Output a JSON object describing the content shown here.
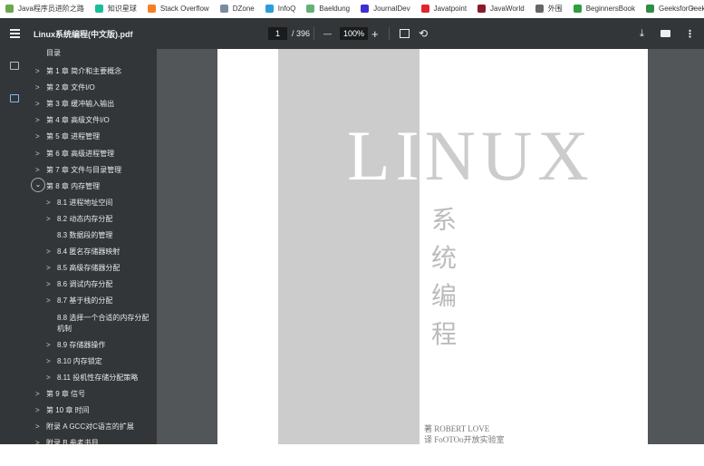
{
  "bookmarks": [
    {
      "label": "Java程序员进阶之路",
      "icon": "java-icon",
      "color": "#6aa84f"
    },
    {
      "label": "知识星球",
      "icon": "planet-icon",
      "color": "#1abc9c"
    },
    {
      "label": "Stack Overflow",
      "icon": "stackoverflow-icon",
      "color": "#f48024"
    },
    {
      "label": "DZone",
      "icon": "dzone-icon",
      "color": "#7a8ca3"
    },
    {
      "label": "InfoQ",
      "icon": "infoq-icon",
      "color": "#2d9cdb"
    },
    {
      "label": "Baeldung",
      "icon": "baeldung-icon",
      "color": "#63b175"
    },
    {
      "label": "JournalDev",
      "icon": "journaldev-icon",
      "color": "#3f2fcf"
    },
    {
      "label": "Javatpoint",
      "icon": "javatpoint-icon",
      "color": "#e3242b"
    },
    {
      "label": "JavaWorld",
      "icon": "javaworld-icon",
      "color": "#8b1a2b"
    },
    {
      "label": "外围",
      "icon": "folder-icon",
      "color": "#666666"
    },
    {
      "label": "BeginnersBook",
      "icon": "beginnersbook-icon",
      "color": "#2e9e3e"
    },
    {
      "label": "GeeksforGeeks",
      "icon": "geeksforgeeks-icon",
      "color": "#2f8d46"
    }
  ],
  "more": "»",
  "toolbar": {
    "title": "Linux系统编程(中文版).pdf",
    "page": "1",
    "total": "/ 396",
    "zoom": "100%",
    "minus": "—",
    "plus": "+"
  },
  "toc": {
    "header": "目录",
    "items": [
      {
        "label": "第 1 章 简介和主要概念",
        "level": 0,
        "chev": ">"
      },
      {
        "label": "第 2 章 文件I/O",
        "level": 0,
        "chev": ">"
      },
      {
        "label": "第 3 章 缓冲输入输出",
        "level": 0,
        "chev": ">"
      },
      {
        "label": "第 4 章 高级文件I/O",
        "level": 0,
        "chev": ">"
      },
      {
        "label": "第 5 章 进程管理",
        "level": 0,
        "chev": ">"
      },
      {
        "label": "第 6 章 高级进程管理",
        "level": 0,
        "chev": ">"
      },
      {
        "label": "第 7 章 文件与目录管理",
        "level": 0,
        "chev": ">"
      },
      {
        "label": "第 8 章 内存管理",
        "level": 0,
        "chev": "v",
        "expanded": true
      },
      {
        "label": "8.1 进程地址空间",
        "level": 1,
        "chev": ">"
      },
      {
        "label": "8.2 动态内存分配",
        "level": 1,
        "chev": ">"
      },
      {
        "label": "8.3 数据段的管理",
        "level": 1,
        "chev": ""
      },
      {
        "label": "8.4 匿名存储器映射",
        "level": 1,
        "chev": ">"
      },
      {
        "label": "8.5 高级存储器分配",
        "level": 1,
        "chev": ">"
      },
      {
        "label": "8.6 调试内存分配",
        "level": 1,
        "chev": ">"
      },
      {
        "label": "8.7 基于栈的分配",
        "level": 1,
        "chev": ">"
      },
      {
        "label": "8.8 选择一个合适的内存分配机制",
        "level": 1,
        "chev": "",
        "tall": true
      },
      {
        "label": "8.9 存储器操作",
        "level": 1,
        "chev": ">"
      },
      {
        "label": "8.10 内存锁定",
        "level": 1,
        "chev": ">"
      },
      {
        "label": "8.11 投机性存储分配策略",
        "level": 1,
        "chev": ">"
      },
      {
        "label": "第 9 章 信号",
        "level": 0,
        "chev": ">"
      },
      {
        "label": "第 10 章 时间",
        "level": 0,
        "chev": ">"
      },
      {
        "label": "附录 A GCC对C语言的扩展",
        "level": 0,
        "chev": ">"
      },
      {
        "label": "附录 B 参考书目",
        "level": 0,
        "chev": ">"
      }
    ]
  },
  "pdf": {
    "title": "LINUX",
    "subtitle": "系统编程",
    "author": "著 ROBERT LOVE",
    "translator": "译 FoOTOo开放实验室"
  }
}
